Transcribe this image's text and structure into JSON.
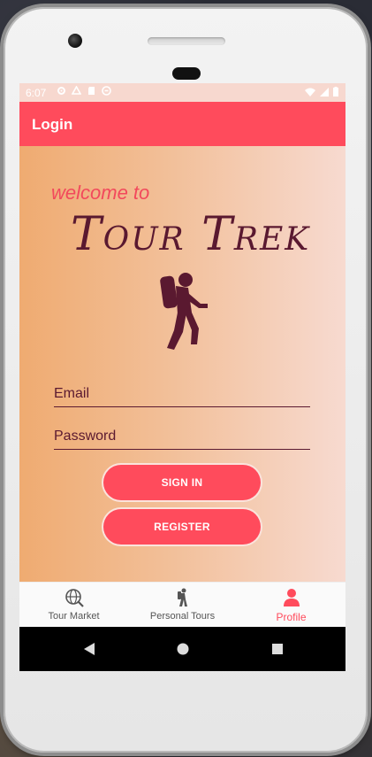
{
  "status": {
    "time": "6:07"
  },
  "appbar": {
    "title": "Login"
  },
  "hero": {
    "welcome": "welcome to",
    "brand": "Tour Trek"
  },
  "form": {
    "email_placeholder": "Email",
    "password_placeholder": "Password",
    "signin_label": "SIGN IN",
    "register_label": "REGISTER"
  },
  "nav": {
    "items": [
      {
        "label": "Tour Market",
        "icon": "globe-search-icon"
      },
      {
        "label": "Personal Tours",
        "icon": "hiker-icon"
      },
      {
        "label": "Profile",
        "icon": "person-icon",
        "active": true
      }
    ]
  },
  "colors": {
    "accent": "#ff4b5c",
    "brand": "#5a1930"
  }
}
